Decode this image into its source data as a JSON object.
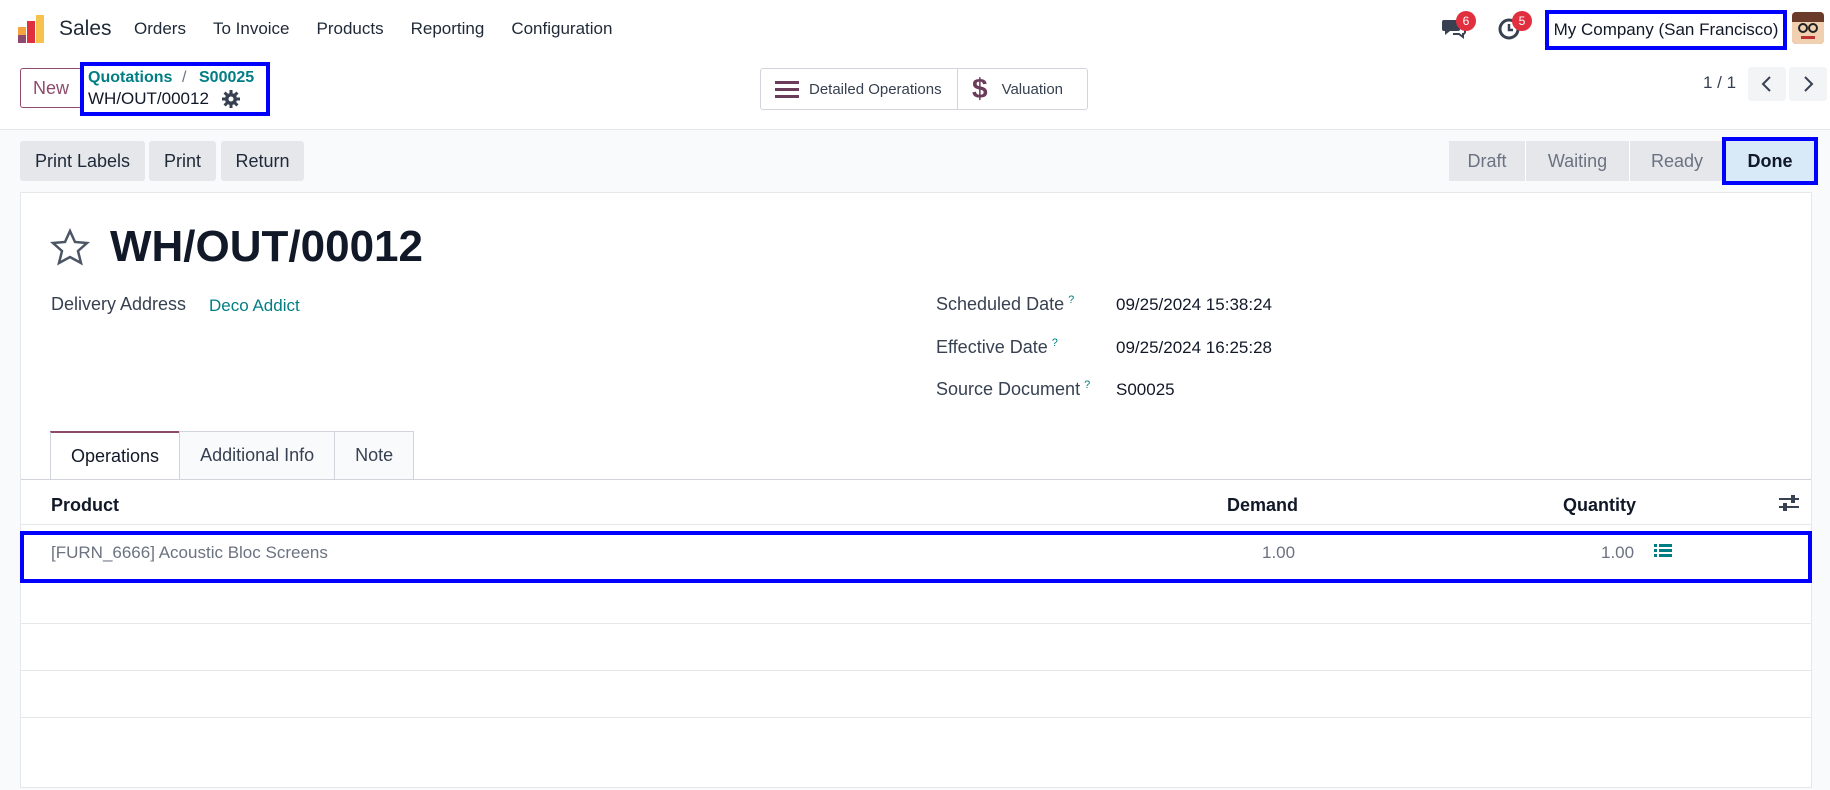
{
  "app": {
    "name": "Sales"
  },
  "menu": [
    "Orders",
    "To Invoice",
    "Products",
    "Reporting",
    "Configuration"
  ],
  "systray": {
    "messages_count": "6",
    "activities_count": "5",
    "company": "My Company (San Francisco)"
  },
  "control": {
    "new_label": "New",
    "breadcrumb": {
      "parent": "Quotations",
      "separator": "/",
      "order": "S00025",
      "current": "WH/OUT/00012"
    },
    "smart_buttons": {
      "detailed_operations": "Detailed Operations",
      "valuation": "Valuation"
    },
    "pager": "1 / 1"
  },
  "actions": {
    "print_labels": "Print Labels",
    "print": "Print",
    "return": "Return"
  },
  "stages": [
    "Draft",
    "Waiting",
    "Ready",
    "Done"
  ],
  "record": {
    "title": "WH/OUT/00012",
    "delivery_address_label": "Delivery Address",
    "delivery_address": "Deco Addict",
    "scheduled_date_label": "Scheduled Date",
    "scheduled_date": "09/25/2024 15:38:24",
    "effective_date_label": "Effective Date",
    "effective_date": "09/25/2024 16:25:28",
    "source_document_label": "Source Document",
    "source_document": "S00025",
    "help_mark": "?"
  },
  "tabs": [
    "Operations",
    "Additional Info",
    "Note"
  ],
  "table": {
    "columns": {
      "product": "Product",
      "demand": "Demand",
      "quantity": "Quantity"
    },
    "rows": [
      {
        "product": "[FURN_6666] Acoustic Bloc Screens",
        "demand": "1.00",
        "quantity": "1.00"
      }
    ]
  },
  "colors": {
    "accent": "#8d4a6c",
    "link": "#017e84",
    "highlight": "#0000ff"
  }
}
